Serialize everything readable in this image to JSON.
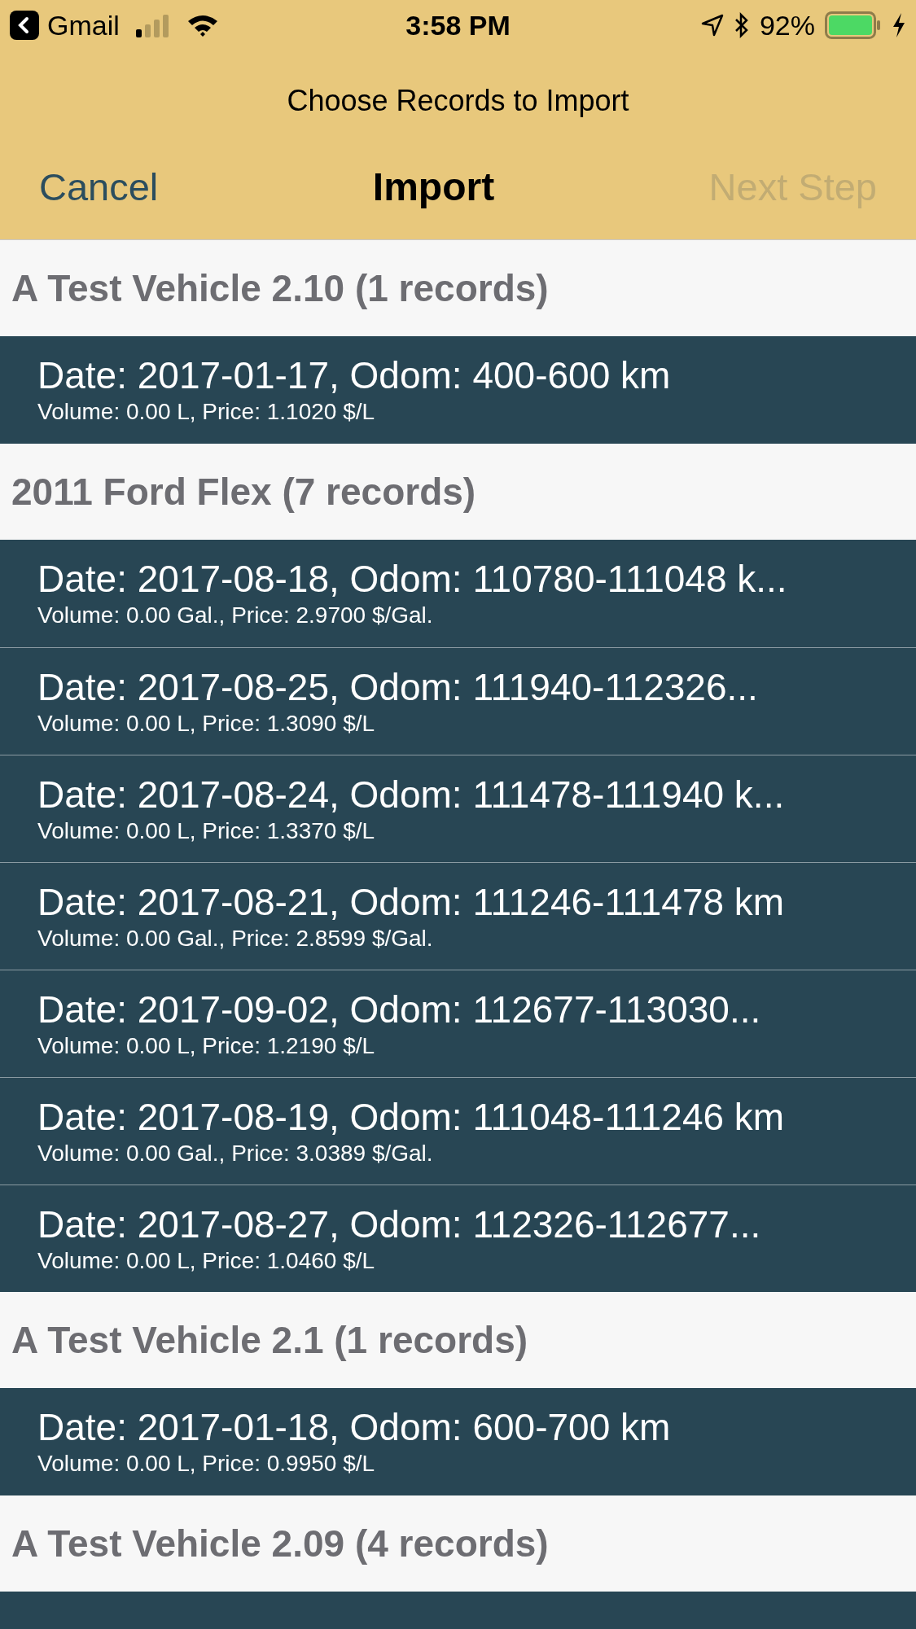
{
  "status_bar": {
    "back_app": "Gmail",
    "time": "3:58 PM",
    "battery": "92%"
  },
  "nav": {
    "subtitle": "Choose Records to Import",
    "title": "Import",
    "left": {
      "label": "Cancel",
      "disabled": false
    },
    "right": {
      "label": "Next Step",
      "disabled": true
    }
  },
  "sections": [
    {
      "title": "A Test Vehicle 2.10 (1 records)",
      "rows": [
        {
          "title": "Date: 2017-01-17, Odom: 400-600 km",
          "detail": "Volume: 0.00 L, Price: 1.1020 $/L"
        }
      ]
    },
    {
      "title": "2011 Ford Flex (7 records)",
      "rows": [
        {
          "title": "Date: 2017-08-18, Odom: 110780-111048 k...",
          "detail": "Volume: 0.00 Gal., Price: 2.9700 $/Gal."
        },
        {
          "title": "Date: 2017-08-25, Odom: 111940-112326...",
          "detail": "Volume: 0.00 L, Price: 1.3090 $/L"
        },
        {
          "title": "Date: 2017-08-24, Odom: 111478-111940 k...",
          "detail": "Volume: 0.00 L, Price: 1.3370 $/L"
        },
        {
          "title": "Date: 2017-08-21, Odom: 111246-111478 km",
          "detail": "Volume: 0.00 Gal., Price: 2.8599 $/Gal."
        },
        {
          "title": "Date: 2017-09-02, Odom: 112677-113030...",
          "detail": "Volume: 0.00 L, Price: 1.2190 $/L"
        },
        {
          "title": "Date: 2017-08-19, Odom: 111048-111246 km",
          "detail": "Volume: 0.00 Gal., Price: 3.0389 $/Gal."
        },
        {
          "title": "Date: 2017-08-27, Odom: 112326-112677...",
          "detail": "Volume: 0.00 L, Price: 1.0460 $/L"
        }
      ]
    },
    {
      "title": "A Test Vehicle 2.1 (1 records)",
      "rows": [
        {
          "title": "Date: 2017-01-18, Odom: 600-700 km",
          "detail": "Volume: 0.00 L, Price: 0.9950 $/L"
        }
      ]
    },
    {
      "title": "A Test Vehicle 2.09 (4 records)",
      "rows": [
        {
          "kind": "cut"
        }
      ]
    }
  ]
}
